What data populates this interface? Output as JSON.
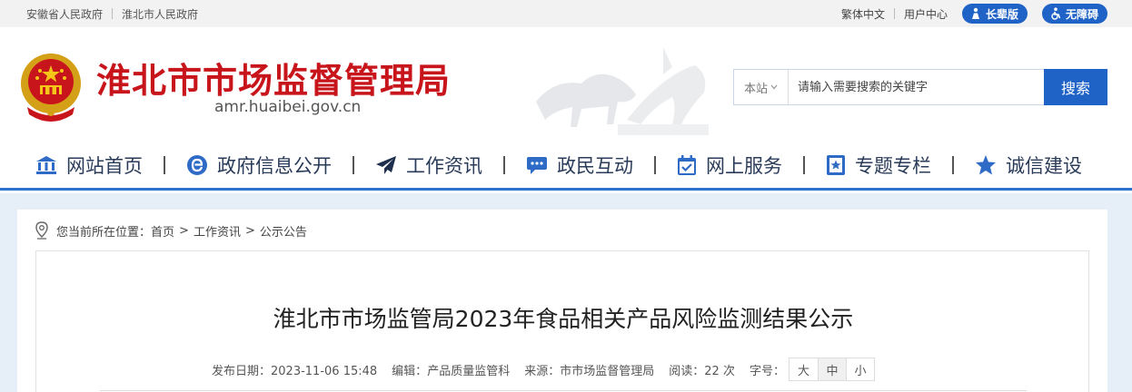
{
  "topbar": {
    "links": [
      "安徽省人民政府",
      "淮北市人民政府"
    ],
    "traditional": "繁体中文",
    "user_center": "用户中心",
    "elderly_mode": "长辈版",
    "accessibility": "无障碍"
  },
  "header": {
    "title": "淮北市市场监督管理局",
    "url": "amr.huaibei.gov.cn"
  },
  "search": {
    "scope": "本站",
    "placeholder": "请输入需要搜索的关键字",
    "button": "搜索"
  },
  "nav": {
    "items": [
      {
        "label": "网站首页",
        "icon": "bank-icon"
      },
      {
        "label": "政府信息公开",
        "icon": "e-icon"
      },
      {
        "label": "工作资讯",
        "icon": "paper-plane-icon"
      },
      {
        "label": "政民互动",
        "icon": "chat-icon"
      },
      {
        "label": "网上服务",
        "icon": "calendar-check-icon"
      },
      {
        "label": "专题专栏",
        "icon": "star-book-icon"
      },
      {
        "label": "诚信建设",
        "icon": "star-icon"
      }
    ]
  },
  "breadcrumb": {
    "prefix": "您当前所在位置：",
    "items": [
      "首页",
      "工作资讯",
      "公示公告"
    ],
    "separator": ">"
  },
  "article": {
    "title": "淮北市市场监管局2023年食品相关产品风险监测结果公示",
    "publish_label": "发布日期：",
    "publish_date": "2023-11-06 15:48",
    "editor_label": "编辑：",
    "editor": "产品质量监管科",
    "source_label": "来源：",
    "source": "市市场监督管理局",
    "views_label": "阅读：",
    "views": "22",
    "views_unit": "次",
    "fontsize_label": "字号：",
    "fontsizes": [
      "大",
      "中",
      "小"
    ],
    "active_fontsize": "中"
  },
  "colors": {
    "brand_blue": "#1f63c7",
    "title_red": "#c8141b",
    "nav_text": "#2a3b5a",
    "content_bg": "#e6eef8"
  }
}
